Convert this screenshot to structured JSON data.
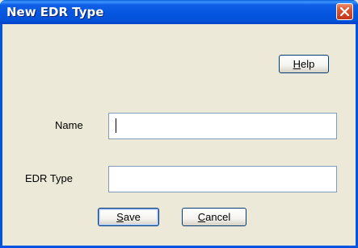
{
  "window": {
    "title": "New EDR Type"
  },
  "buttons": {
    "help_mnemonic": "H",
    "help_rest": "elp",
    "save_mnemonic": "S",
    "save_rest": "ave",
    "cancel_mnemonic": "C",
    "cancel_rest": "ancel"
  },
  "form": {
    "name_label": "Name",
    "name_value": "",
    "edr_type_label": "EDR Type",
    "edr_type_value": ""
  },
  "icons": {
    "close": "close-x-icon"
  },
  "colors": {
    "title_bar": "#0054e3",
    "close_button": "#d8532e",
    "dialog_background": "#ece9d8"
  }
}
